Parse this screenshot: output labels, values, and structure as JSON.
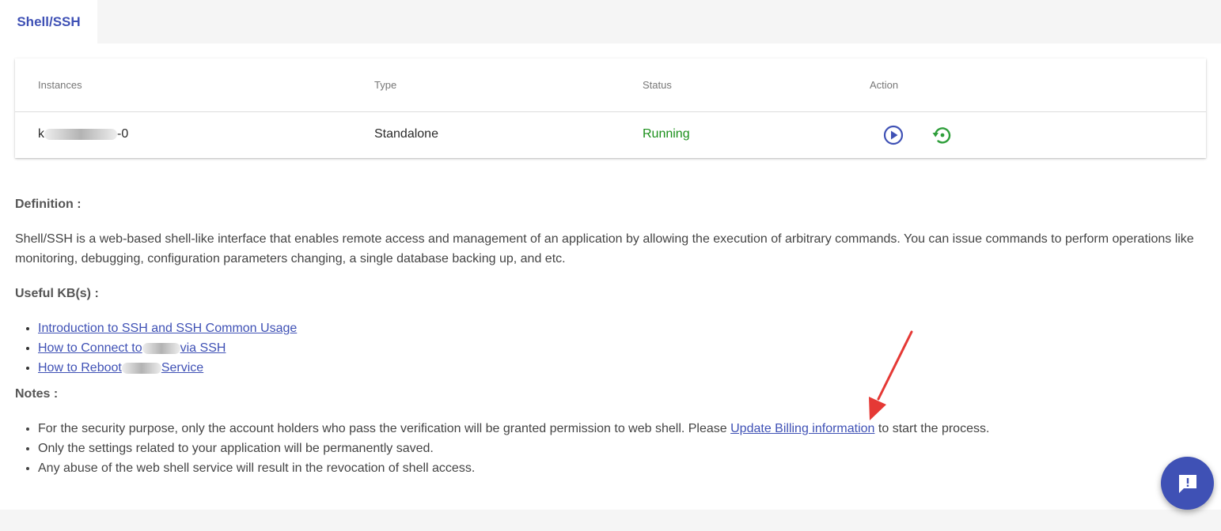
{
  "tabs": [
    {
      "label": "Shell/SSH",
      "active": true
    }
  ],
  "table": {
    "headers": [
      "Instances",
      "Type",
      "Status",
      "Action"
    ],
    "rows": [
      {
        "instance_prefix": "k",
        "instance_suffix": "-0",
        "type": "Standalone",
        "status": "Running"
      }
    ],
    "actions": [
      {
        "icon": "play-circle-icon",
        "color": "#3f51b5"
      },
      {
        "icon": "restart-icon",
        "color": "#2e9e3a"
      }
    ]
  },
  "definition": {
    "heading": "Definition :",
    "text": "Shell/SSH is a web-based shell-like interface that enables remote access and management of an application by allowing the execution of arbitrary commands. You can issue commands to perform operations like monitoring, debugging, configuration parameters changing, a single database backing up, and etc."
  },
  "kb": {
    "heading": "Useful KB(s) :",
    "links": [
      {
        "parts": [
          "Introduction to SSH and SSH Common Usage"
        ]
      },
      {
        "parts": [
          "How to Connect to",
          "via SSH"
        ]
      },
      {
        "parts": [
          "How to Reboot",
          "Service"
        ]
      }
    ]
  },
  "notes": {
    "heading": "Notes :",
    "items": [
      {
        "before": "For the security purpose, only the account holders who pass the verification will be granted permission to web shell. Please ",
        "link": "Update Billing information",
        "after": " to start the process."
      },
      {
        "text": "Only the settings related to your application will be permanently saved."
      },
      {
        "text": "Any abuse of the web shell service will result in the revocation of shell access."
      }
    ]
  },
  "colors": {
    "accent": "#3f51b5",
    "running": "#1a8f1a",
    "annotation": "#e53935"
  },
  "fab_icon": "feedback-icon"
}
